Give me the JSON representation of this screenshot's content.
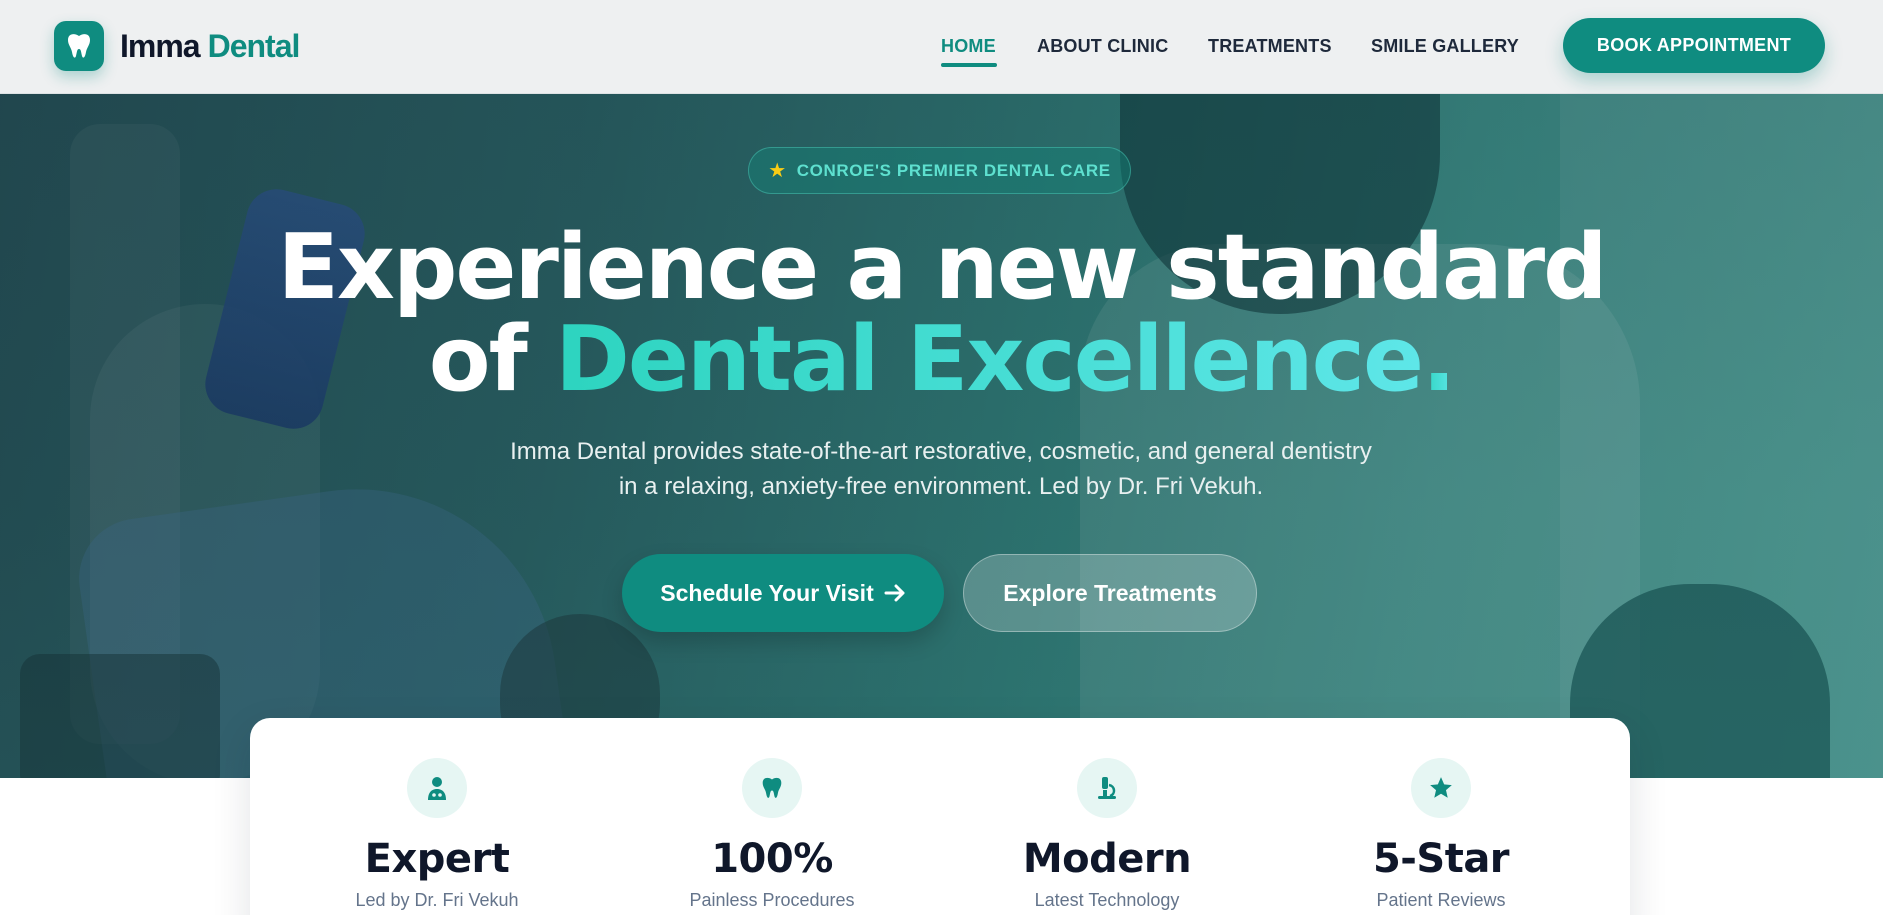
{
  "brand": {
    "name_part1": "Imma",
    "name_part2": "Dental",
    "logo_icon": "tooth-icon",
    "accent_color": "#0f8c80"
  },
  "nav": {
    "items": [
      {
        "label": "HOME",
        "active": true
      },
      {
        "label": "ABOUT CLINIC",
        "active": false
      },
      {
        "label": "TREATMENTS",
        "active": false
      },
      {
        "label": "SMILE GALLERY",
        "active": false
      }
    ],
    "cta_label": "BOOK APPOINTMENT"
  },
  "hero": {
    "badge_icon": "star-icon",
    "badge_text": "CONROE'S PREMIER DENTAL CARE",
    "headline_line1": "Experience a new standard",
    "headline_line2_prefix": "of",
    "headline_accent": "Dental Excellence",
    "headline_period": ".",
    "subtitle_line1": "Imma Dental provides state-of-the-art restorative, cosmetic, and general dentistry",
    "subtitle_line2": "in a relaxing, anxiety-free environment. Led by Dr. Fri Vekuh.",
    "primary_cta": "Schedule Your Visit",
    "primary_cta_icon": "arrow-right-icon",
    "secondary_cta": "Explore Treatments"
  },
  "stats": [
    {
      "icon": "doctor-icon",
      "value": "Expert",
      "label": "Led by Dr. Fri Vekuh"
    },
    {
      "icon": "tooth-icon",
      "value": "100%",
      "label": "Painless Procedures"
    },
    {
      "icon": "microscope-icon",
      "value": "Modern",
      "label": "Latest Technology"
    },
    {
      "icon": "star-icon",
      "value": "5-Star",
      "label": "Patient Reviews"
    }
  ]
}
